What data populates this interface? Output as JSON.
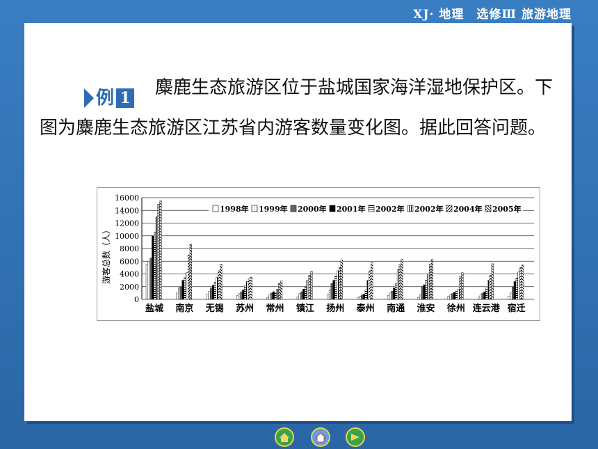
{
  "header": {
    "text": "XJ· 地理　选修Ⅲ 旅游地理"
  },
  "badge": {
    "word": "例",
    "number": "1"
  },
  "paragraph": "麋鹿生态旅游区位于盐城国家海洋湿地保护区。下图为麋鹿生态旅游区江苏省内游客数量变化图。据此回答问题。",
  "colors": {
    "frame": "#2f6fb2",
    "accent": "#2d6db5"
  },
  "nav": {
    "prev_icon": "home-prev-icon",
    "home_icon": "house-icon",
    "next_icon": "home-next-icon"
  },
  "chart_data": {
    "type": "bar",
    "title": "",
    "xlabel": "",
    "ylabel": "游客总数（人）",
    "ylim": [
      0,
      16000
    ],
    "yticks": [
      0,
      2000,
      4000,
      6000,
      8000,
      10000,
      12000,
      14000,
      16000
    ],
    "grid": true,
    "legend_placement": "top",
    "categories": [
      "盐城",
      "南京",
      "无锡",
      "苏州",
      "常州",
      "镇江",
      "扬州",
      "泰州",
      "南通",
      "淮安",
      "徐州",
      "连云港",
      "宿迁"
    ],
    "series": [
      {
        "name": "1998年",
        "values": [
          5500,
          1000,
          800,
          600,
          300,
          400,
          800,
          300,
          600,
          300,
          500,
          400,
          500
        ]
      },
      {
        "name": "1999年",
        "values": [
          6000,
          1800,
          1300,
          900,
          700,
          900,
          1500,
          500,
          1000,
          700,
          700,
          700,
          1000
        ]
      },
      {
        "name": "2000年",
        "values": [
          6500,
          2000,
          1800,
          1200,
          1000,
          1200,
          2500,
          700,
          1300,
          2000,
          900,
          1000,
          2000
        ]
      },
      {
        "name": "2001年",
        "values": [
          10000,
          3000,
          2200,
          1500,
          1200,
          1600,
          3000,
          800,
          1800,
          2300,
          1100,
          1200,
          2800
        ]
      },
      {
        "name": "2002年",
        "values": [
          10500,
          3500,
          2700,
          2200,
          1100,
          2000,
          3700,
          1500,
          2500,
          3000,
          1300,
          1800,
          3300
        ]
      },
      {
        "name": "2002年",
        "values": [
          13000,
          4200,
          3500,
          2800,
          1600,
          3000,
          4500,
          3000,
          4700,
          4000,
          1600,
          3000,
          4300
        ]
      },
      {
        "name": "2004年",
        "values": [
          15000,
          7000,
          4500,
          3200,
          2500,
          3800,
          5000,
          4500,
          5500,
          5500,
          3600,
          3800,
          5000
        ]
      },
      {
        "name": "2005年",
        "values": [
          15500,
          8700,
          5500,
          3500,
          2900,
          4400,
          6200,
          5800,
          6300,
          6300,
          4200,
          5600,
          5400
        ]
      }
    ]
  }
}
